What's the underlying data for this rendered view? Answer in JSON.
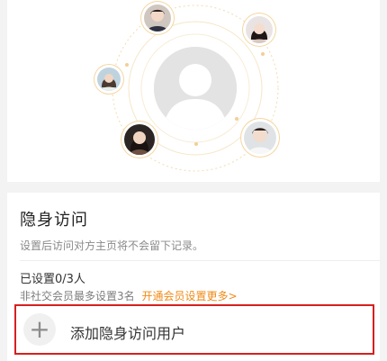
{
  "section": {
    "title": "隐身访问",
    "description": "设置后访问对方主页将不会留下记录。",
    "status": "已设置0/3人",
    "limit_text": "非社交会员最多设置3名",
    "upgrade_link": "开通会员设置更多",
    "upgrade_chevron": ">"
  },
  "add_button": {
    "plus": "+",
    "label": "添加隐身访问用户"
  },
  "icons": {
    "center_avatar": "default-user-avatar-icon",
    "add": "plus-icon"
  },
  "colors": {
    "accent": "#f08a16",
    "highlight_border": "#d71f1f",
    "orbit": "#f2cf97"
  }
}
